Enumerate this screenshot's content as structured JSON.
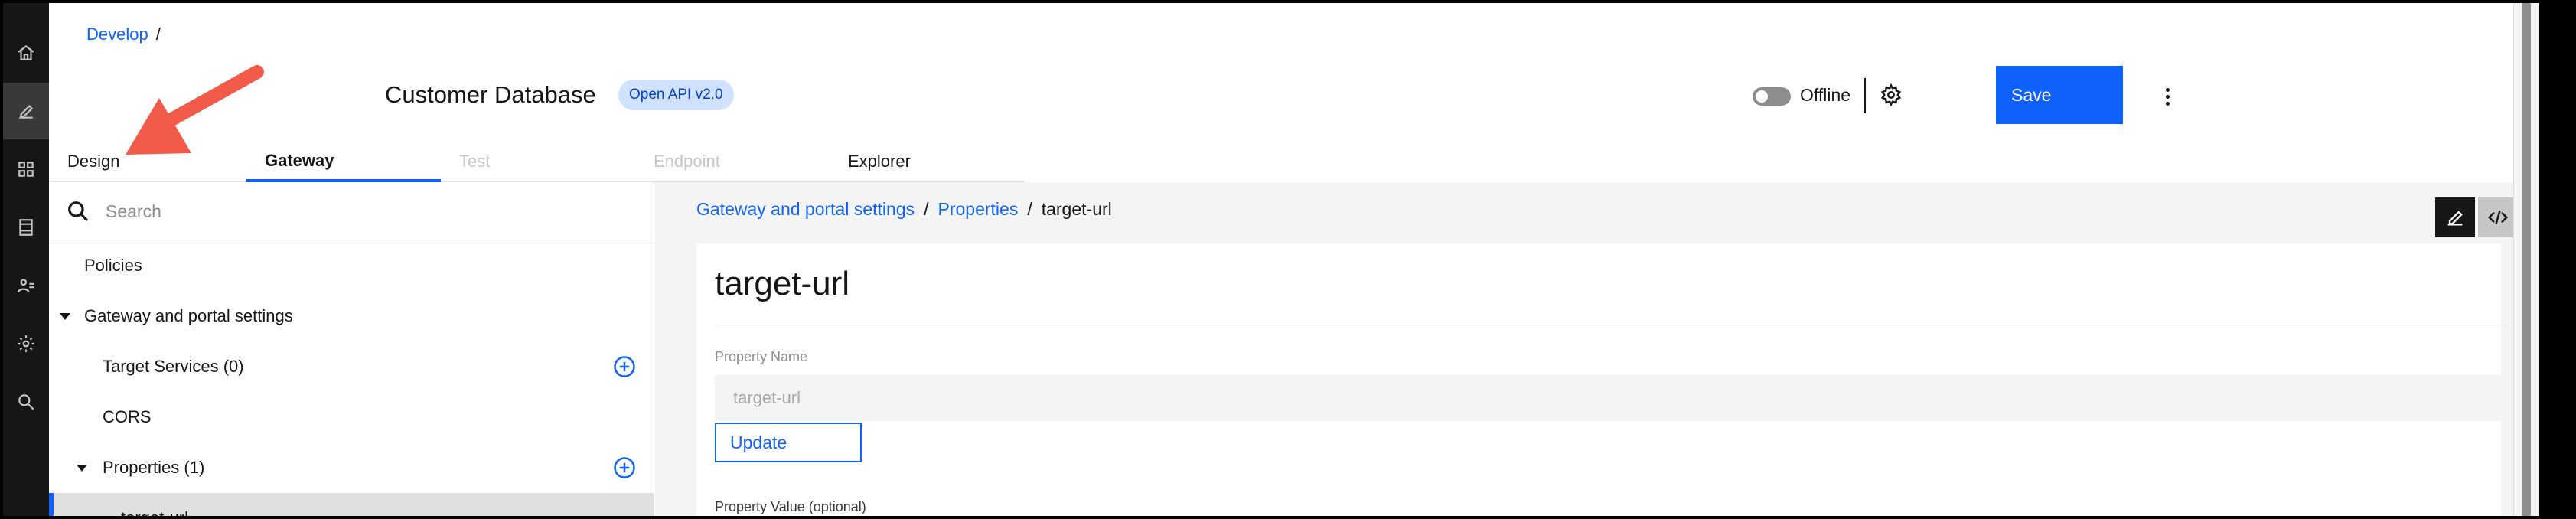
{
  "rail": {
    "items": [
      {
        "icon": "home-icon"
      },
      {
        "icon": "edit-icon"
      },
      {
        "icon": "grid-icon"
      },
      {
        "icon": "catalog-icon"
      },
      {
        "icon": "users-icon"
      },
      {
        "icon": "settings-icon"
      },
      {
        "icon": "search-icon"
      }
    ]
  },
  "header": {
    "breadcrumb": {
      "link": "Develop",
      "separator": "/"
    },
    "api_title": "Customer Database",
    "api_badge": "Open API v2.0",
    "status_label": "Offline",
    "save_label": "Save"
  },
  "tabs": [
    {
      "label": "Design",
      "state": "normal"
    },
    {
      "label": "Gateway",
      "state": "selected"
    },
    {
      "label": "Test",
      "state": "disabled"
    },
    {
      "label": "Endpoint",
      "state": "disabled"
    },
    {
      "label": "Explorer",
      "state": "normal"
    }
  ],
  "left_pane": {
    "search_placeholder": "Search",
    "tree": [
      {
        "label": "Policies"
      },
      {
        "label": "Gateway and portal settings",
        "expanded": true
      },
      {
        "label": "Target Services (0)",
        "has_add": true
      },
      {
        "label": "CORS"
      },
      {
        "label": "Properties (1)",
        "expanded": true,
        "has_add": true
      },
      {
        "label": "target-url",
        "selected": true
      }
    ]
  },
  "right_pane": {
    "breadcrumb": [
      {
        "label": "Gateway and portal settings",
        "link": true
      },
      {
        "label": "/"
      },
      {
        "label": "Properties",
        "link": true
      },
      {
        "label": "/"
      },
      {
        "label": "target-url",
        "link": false
      }
    ],
    "card": {
      "title": "target-url",
      "property_name_label": "Property Name",
      "property_name_value": "target-url",
      "update_label": "Update",
      "property_value_label": "Property Value (optional)"
    }
  },
  "colors": {
    "accent": "#0f62fe",
    "rail_bg": "#161616",
    "callout": "#f25a4a"
  }
}
